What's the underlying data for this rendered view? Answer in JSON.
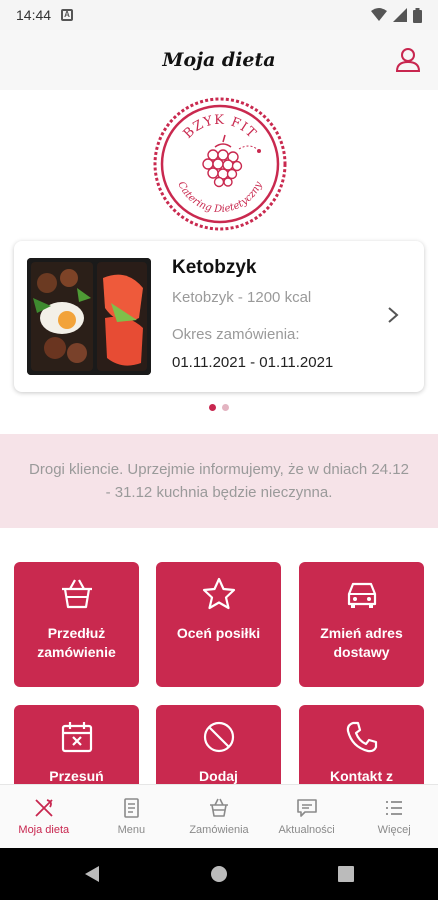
{
  "status_bar": {
    "time": "14:44",
    "notification_icon": "A"
  },
  "header": {
    "title": "Moja dieta"
  },
  "logo": {
    "brand": "BZYK FIT",
    "tagline": "Catering Dietetyczny"
  },
  "order_card": {
    "diet_name": "Ketobzyk",
    "diet_subtitle": "Ketobzyk - 1200 kcal",
    "period_label": "Okres zamówienia:",
    "period_value": "01.11.2021 - 01.11.2021"
  },
  "carousel": {
    "page_count": 2,
    "active_index": 0
  },
  "notice": {
    "text": "Drogi kliencie. Uprzejmie informujemy, że w dniach 24.12 - 31.12 kuchnia będzie nieczynna."
  },
  "tiles": [
    {
      "label": "Przedłuż zamówienie",
      "icon": "basket-icon"
    },
    {
      "label": "Oceń posiłki",
      "icon": "star-icon"
    },
    {
      "label": "Zmień adres dostawy",
      "icon": "car-icon"
    },
    {
      "label": "Przesuń",
      "icon": "calendar-cancel-icon"
    },
    {
      "label": "Dodaj",
      "icon": "block-icon"
    },
    {
      "label": "Kontakt z",
      "icon": "phone-icon"
    }
  ],
  "bottom_nav": [
    {
      "label": "Moja dieta",
      "icon": "cutlery-icon",
      "active": true
    },
    {
      "label": "Menu",
      "icon": "menu-book-icon",
      "active": false
    },
    {
      "label": "Zamówienia",
      "icon": "basket-icon",
      "active": false
    },
    {
      "label": "Aktualności",
      "icon": "chat-icon",
      "active": false
    },
    {
      "label": "Więcej",
      "icon": "list-icon",
      "active": false
    }
  ],
  "colors": {
    "accent": "#c9294f",
    "notice_bg": "#f6e3e8",
    "muted_text": "#9a9a9a"
  }
}
